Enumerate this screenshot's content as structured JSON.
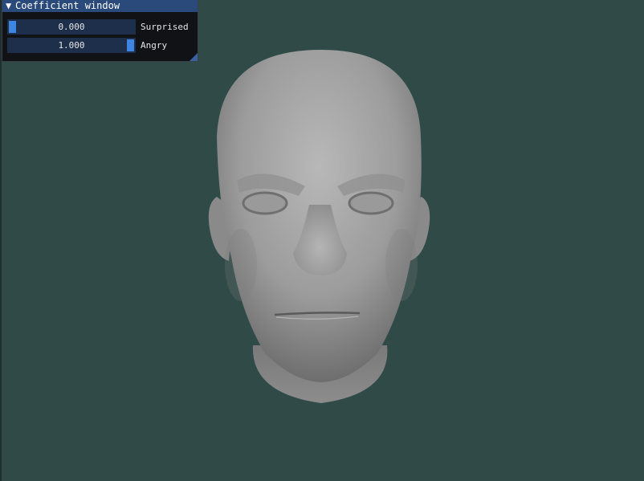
{
  "window": {
    "title": "Coefficient window",
    "collapse_icon": "collapse-triangle-icon"
  },
  "coefficients": [
    {
      "label": "Surprised",
      "value_text": "0.000",
      "value": 0.0
    },
    {
      "label": "Angry",
      "value_text": "1.000",
      "value": 1.0
    }
  ],
  "colors": {
    "background": "#2f4a47",
    "titlebar": "#294a7a",
    "slider_frame": "#1d2f4a",
    "slider_grab": "#3d85e0",
    "head": "#a6a6a6"
  }
}
